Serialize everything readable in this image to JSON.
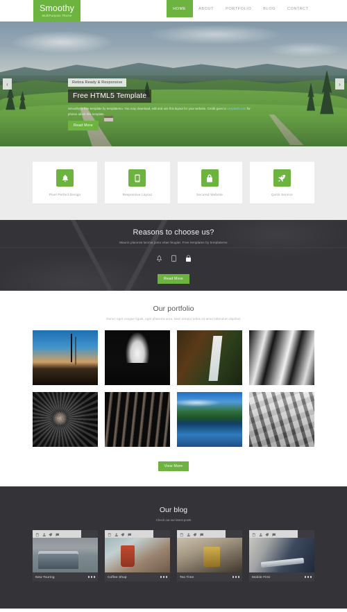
{
  "header": {
    "logo_title": "Smoothy",
    "logo_subtitle": "MultiPurpose Theme",
    "nav": [
      {
        "label": "HOME",
        "active": true
      },
      {
        "label": "ABOUT",
        "active": false
      },
      {
        "label": "PORTFOLIO",
        "active": false
      },
      {
        "label": "BLOG",
        "active": false
      },
      {
        "label": "CONTACT",
        "active": false
      }
    ]
  },
  "hero": {
    "tagline": "Retina Ready & Responsive",
    "headline": "Free HTML5 Template",
    "paragraph_before": "Smoothy is free template by templatemo. You may download, edit and use this layout for your website. Credit goes to ",
    "paragraph_link": "unsplash.com",
    "paragraph_after": " for photos about this template.",
    "button": "Read More",
    "prev_arrow": "‹",
    "next_arrow": "›"
  },
  "features": [
    {
      "label": "Pixel Perfect Design",
      "icon": "bell-icon"
    },
    {
      "label": "Responsive Layout",
      "icon": "tablet-icon"
    },
    {
      "label": "Secured Website",
      "icon": "lock-icon"
    },
    {
      "label": "Quick Service",
      "icon": "rocket-icon"
    }
  ],
  "reasons": {
    "title": "Reasons to choose us?",
    "subtitle": "Mauris placerat lacinia justo vitae feugiat. Free templates by templatemo",
    "icons": [
      "bell-icon",
      "tablet-icon",
      "lock-icon"
    ],
    "button": "Read More"
  },
  "portfolio": {
    "title": "Our portfolio",
    "subtitle": "Donec eget congue ligula, eget pharetra urna. Nam tempor tellus sit amet bibendum dapibus",
    "items": [
      {
        "alt": "dry-field-under-blue-sky"
      },
      {
        "alt": "dark-forest-path"
      },
      {
        "alt": "autumn-waterfall"
      },
      {
        "alt": "black-white-abstract-curves"
      },
      {
        "alt": "jet-engine-turbine"
      },
      {
        "alt": "dark-vertical-stripes"
      },
      {
        "alt": "lake-reflection-trees"
      },
      {
        "alt": "concrete-memorial-blocks"
      }
    ],
    "view_more": "View More"
  },
  "blog": {
    "title": "Our blog",
    "subtitle": "Check out our latest posts",
    "meta_icons": [
      "calendar-icon",
      "user-icon",
      "tag-icon",
      "comment-icon"
    ],
    "posts": [
      {
        "title": "New Touring"
      },
      {
        "title": "Coffee Shop"
      },
      {
        "title": "Tea Time"
      },
      {
        "title": "Mobile First"
      }
    ]
  },
  "colors": {
    "accent_green": "#6cb33f",
    "dark_section": "#333338",
    "light_gray": "#ececec"
  }
}
